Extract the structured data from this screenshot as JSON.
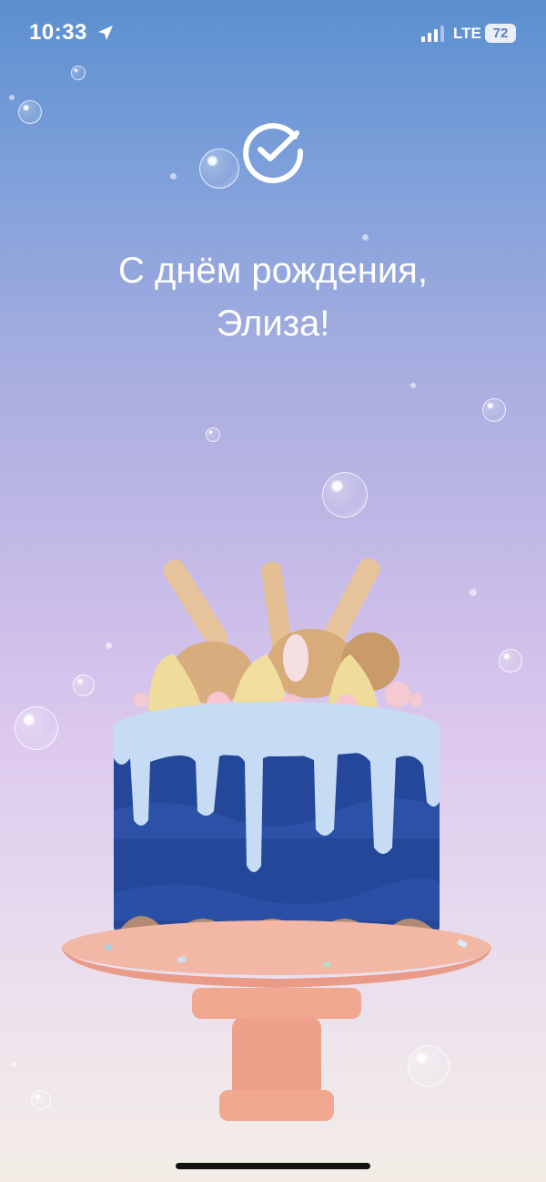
{
  "status_bar": {
    "time": "10:33",
    "network": "LTE",
    "battery": "72"
  },
  "greeting": {
    "line1": "С днём рождения,",
    "line2": "Элиза!"
  },
  "colors": {
    "background_top": "#5b8fd0",
    "background_bottom": "#f3ede6",
    "cake_body": "#25479a",
    "icing": "#b9d4f2",
    "stand": "#f0a28f"
  },
  "icons": {
    "logo": "sber-check-logo-icon",
    "location": "location-arrow-icon",
    "signal": "cellular-signal-icon",
    "battery": "battery-icon"
  }
}
